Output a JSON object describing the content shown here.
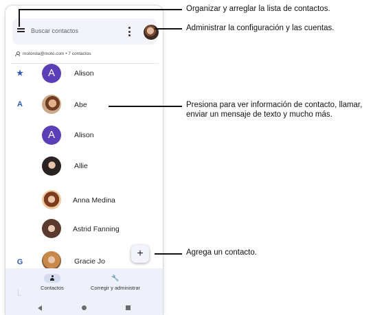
{
  "search": {
    "placeholder": "Buscar contactos",
    "menu_icon": "menu-icon",
    "more_icon": "more-vert-icon"
  },
  "account": {
    "label": "motorola@moto.com • 7 contactos"
  },
  "contacts": [
    {
      "section": "★",
      "initial": "A",
      "name": "Alison",
      "avatar_type": "letter"
    },
    {
      "section": "A",
      "initial": "",
      "name": "Abe",
      "avatar_type": "photo"
    },
    {
      "section": "",
      "initial": "A",
      "name": "Alison",
      "avatar_type": "letter"
    },
    {
      "section": "",
      "initial": "",
      "name": "Allie",
      "avatar_type": "photo"
    },
    {
      "section": "",
      "initial": "",
      "name": "Anna Medina",
      "avatar_type": "photo"
    },
    {
      "section": "",
      "initial": "",
      "name": "Astrid Fanning",
      "avatar_type": "photo"
    },
    {
      "section": "G",
      "initial": "",
      "name": "Gracie Jo",
      "avatar_type": "photo"
    }
  ],
  "fab": {
    "label": "+"
  },
  "bottom_nav": [
    {
      "label": "Contactos",
      "icon": "person-icon"
    },
    {
      "label": "Corregir y administrar",
      "icon": "wrench-icon"
    }
  ],
  "callouts": [
    {
      "text": "Organizar y arreglar la lista de contactos."
    },
    {
      "text": "Administrar la configuración y las cuentas."
    },
    {
      "text": "Presiona para ver información de contacto, llamar, enviar un mensaje de texto y mucho más."
    },
    {
      "text": "Agrega un contacto."
    }
  ],
  "colors": {
    "accent": "#2f5ab8",
    "letter_avatar": "#5b3fb6",
    "nav_bg": "#eef1fb"
  }
}
